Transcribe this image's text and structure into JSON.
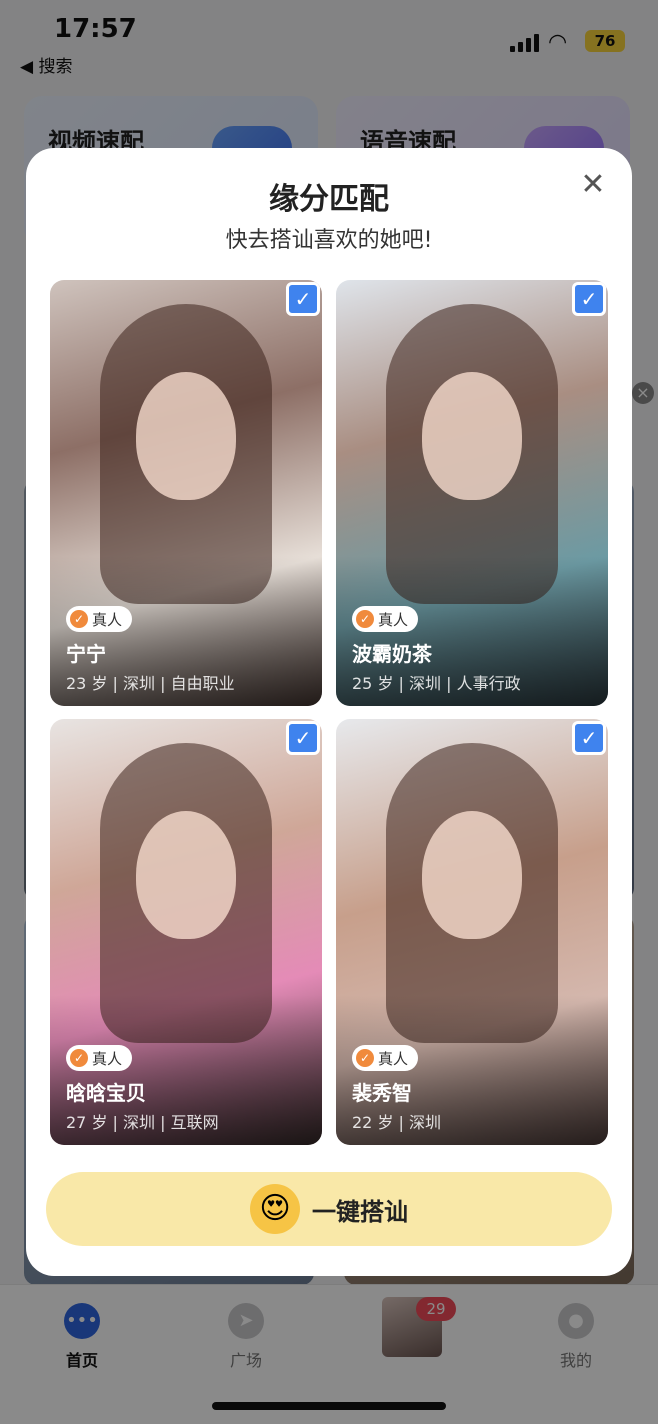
{
  "status_bar": {
    "time": "17:57",
    "back_label": "◀ 搜索",
    "wifi_icon": "wifi-icon",
    "battery": "76"
  },
  "background": {
    "cards": [
      {
        "title": "视频速配"
      },
      {
        "title": "语音速配"
      }
    ]
  },
  "modal": {
    "title": "缘分匹配",
    "subtitle": "快去搭讪喜欢的她吧!",
    "close_glyph": "✕",
    "profiles": [
      {
        "badge": "真人",
        "name": "宁宁",
        "info": "23 岁 | 深圳 | 自由职业",
        "checked": true
      },
      {
        "badge": "真人",
        "name": "波霸奶茶",
        "info": "25 岁 | 深圳 | 人事行政",
        "checked": true
      },
      {
        "badge": "真人",
        "name": "晗晗宝贝",
        "info": "27 岁 | 深圳 | 互联网",
        "checked": true
      },
      {
        "badge": "真人",
        "name": "裴秀智",
        "info": "22 岁 | 深圳",
        "checked": true
      }
    ],
    "cta_emoji": "😍",
    "cta_label": "一键搭讪"
  },
  "tabbar": {
    "tabs": [
      {
        "label": "首页",
        "icon": "chat-bubble-icon",
        "active": true
      },
      {
        "label": "广场",
        "icon": "compass-icon",
        "active": false
      },
      {
        "label": "",
        "icon": "avatar",
        "badge": "29",
        "active": false
      },
      {
        "label": "我的",
        "icon": "person-icon",
        "active": false
      }
    ]
  },
  "colors": {
    "accent": "#3f83ee",
    "cta_bg": "#f9e8a8",
    "badge": "#f24b5a",
    "verified": "#f08a3c"
  }
}
